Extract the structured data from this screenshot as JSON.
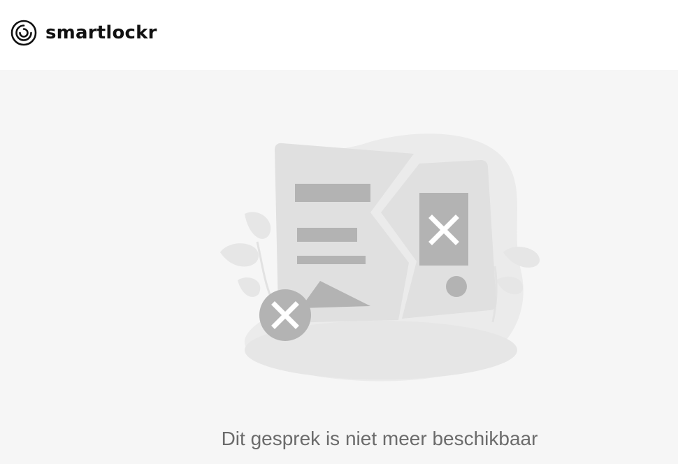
{
  "header": {
    "logo_text": "smartlockr",
    "logo_icon": "smartlockr-logo-icon"
  },
  "main": {
    "illustration_icon": "broken-document-illustration",
    "message": "Dit gesprek is niet meer beschikbaar"
  },
  "colors": {
    "background": "#f6f6f6",
    "header": "#ffffff",
    "message_text": "#6b6b6b",
    "illustration_light": "#e0e0e0",
    "illustration_dark": "#b0b0b0"
  }
}
